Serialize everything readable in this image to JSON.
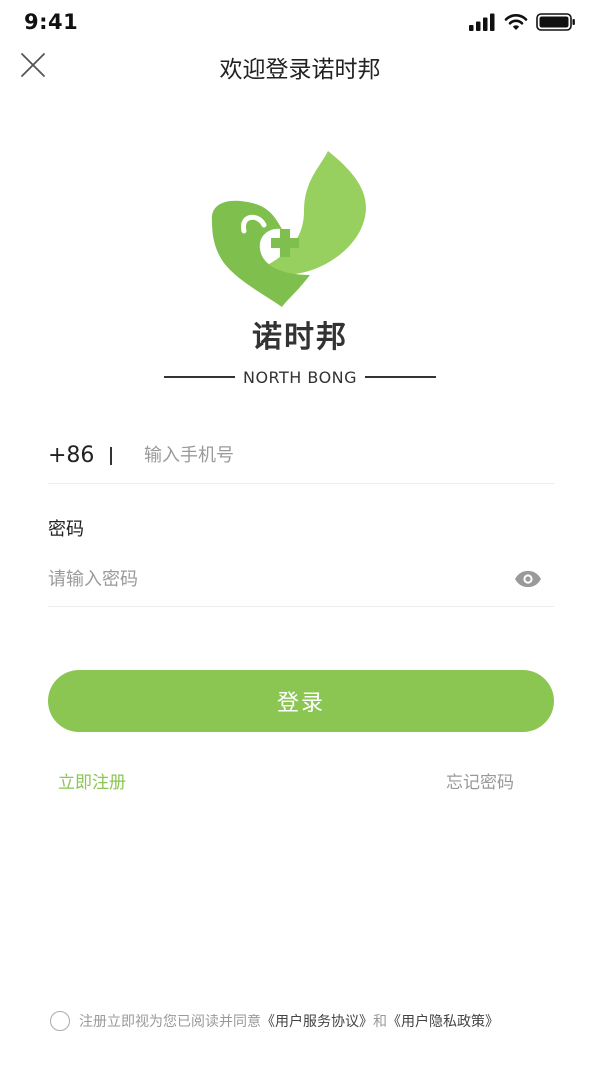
{
  "status_bar": {
    "time": "9:41",
    "icons": [
      "signal-icon",
      "wifi-icon",
      "battery-icon"
    ]
  },
  "nav": {
    "title": "欢迎登录诺时邦",
    "close_icon": "close-icon"
  },
  "brand": {
    "name_cn": "诺时邦",
    "name_en": "NORTH BONG"
  },
  "phone": {
    "country_code": "+86",
    "value": "",
    "placeholder": "输入手机号"
  },
  "password": {
    "label": "密码",
    "value": "",
    "placeholder": "请输入密码",
    "toggle_icon": "eye-icon"
  },
  "actions": {
    "login_label": "登录",
    "register_label": "立即注册",
    "forgot_label": "忘记密码"
  },
  "agreement": {
    "text": "注册立即视为您已阅读并同意",
    "service_link": "《用户服务协议》",
    "and": "和",
    "privacy_link": "《用户隐私政策》",
    "checked": false
  },
  "colors": {
    "brand_green": "#8bc653",
    "logo_green": "#7fbf4d",
    "logo_light": "#97d05f"
  }
}
